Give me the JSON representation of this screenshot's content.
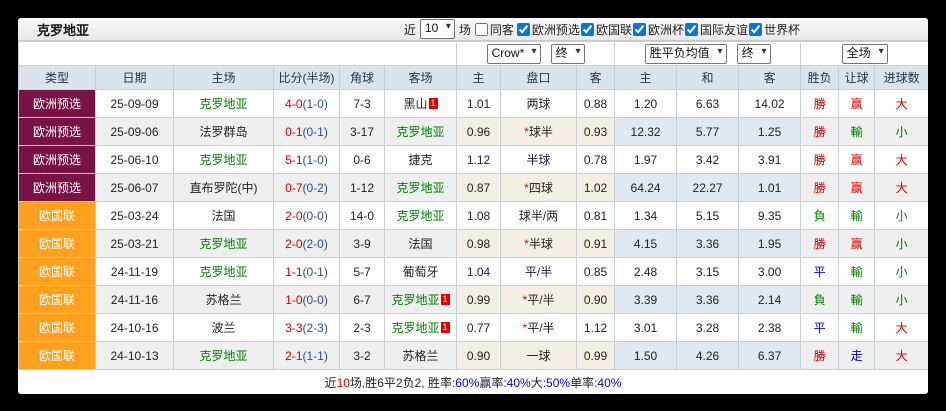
{
  "colors": {
    "comp_purple": "#7a1245",
    "comp_orange": "#ffa01e",
    "team_green": "#008000",
    "score_red": "#e10000",
    "half_score_navy": "#2f4e8e",
    "win_red": "#e10000",
    "loss_green": "#008000",
    "draw_blue": "#0000e6",
    "checkbox_accent": "#0b76d1",
    "header_bg": "#dbe4ed",
    "handicap_col_bg": "#fdf8f0",
    "avg_col_bg": "#e8f2f9"
  },
  "titlebar": {
    "title": "克罗地亚",
    "recent_label": "近",
    "recent_value": "10",
    "matches_label": "场",
    "same_away": {
      "label": "同客",
      "checked": false
    },
    "filters": [
      {
        "label": "欧洲预选",
        "checked": true
      },
      {
        "label": "欧国联",
        "checked": true
      },
      {
        "label": "欧洲杯",
        "checked": true
      },
      {
        "label": "国际友谊",
        "checked": true
      },
      {
        "label": "世界杯",
        "checked": true
      }
    ]
  },
  "controls": {
    "company": "Crow*",
    "final_a": "终",
    "avg": "胜平负均值",
    "final_b": "终",
    "scope": "全场"
  },
  "table": {
    "headers": [
      "类型",
      "日期",
      "主场",
      "比分(半场)",
      "角球",
      "客场",
      "主",
      "盘口",
      "客",
      "主",
      "和",
      "客",
      "胜负",
      "让球",
      "进球数"
    ],
    "rows": [
      {
        "type": "欧洲预选",
        "type_class": "comp-purple",
        "date": "25-09-09",
        "home": "克罗地亚",
        "home_green": true,
        "home_badge": "",
        "score": "4-0",
        "half": "(1-0)",
        "corners": "7-3",
        "away": "黑山",
        "away_green": false,
        "away_badge": "1",
        "let_home": "1.01",
        "handicap_star": "",
        "handicap": "两球",
        "let_away": "0.88",
        "avg_home": "1.20",
        "avg_draw": "6.63",
        "avg_away": "14.02",
        "result": {
          "t": "勝",
          "c": "red"
        },
        "let_result": {
          "t": "赢",
          "c": "red"
        },
        "goals": {
          "t": "大",
          "c": "red"
        }
      },
      {
        "type": "欧洲预选",
        "type_class": "comp-purple",
        "date": "25-09-06",
        "home": "法罗群岛",
        "home_green": false,
        "home_badge": "",
        "score": "0-1",
        "half": "(0-1)",
        "corners": "3-17",
        "away": "克罗地亚",
        "away_green": true,
        "away_badge": "",
        "let_home": "0.96",
        "handicap_star": "*",
        "handicap": "球半",
        "let_away": "0.93",
        "avg_home": "12.32",
        "avg_draw": "5.77",
        "avg_away": "1.25",
        "result": {
          "t": "勝",
          "c": "red"
        },
        "let_result": {
          "t": "輸",
          "c": "green"
        },
        "goals": {
          "t": "小",
          "c": "green"
        }
      },
      {
        "type": "欧洲预选",
        "type_class": "comp-purple",
        "date": "25-06-10",
        "home": "克罗地亚",
        "home_green": true,
        "home_badge": "",
        "score": "5-1",
        "half": "(1-0)",
        "corners": "0-6",
        "away": "捷克",
        "away_green": false,
        "away_badge": "",
        "let_home": "1.12",
        "handicap_star": "",
        "handicap": "半球",
        "let_away": "0.78",
        "avg_home": "1.97",
        "avg_draw": "3.42",
        "avg_away": "3.91",
        "result": {
          "t": "勝",
          "c": "red"
        },
        "let_result": {
          "t": "赢",
          "c": "red"
        },
        "goals": {
          "t": "大",
          "c": "red"
        }
      },
      {
        "type": "欧洲预选",
        "type_class": "comp-purple",
        "date": "25-06-07",
        "home": "直布罗陀(中)",
        "home_green": false,
        "home_badge": "",
        "score": "0-7",
        "half": "(0-2)",
        "corners": "1-12",
        "away": "克罗地亚",
        "away_green": true,
        "away_badge": "",
        "let_home": "0.87",
        "handicap_star": "*",
        "handicap": "四球",
        "let_away": "1.02",
        "avg_home": "64.24",
        "avg_draw": "22.27",
        "avg_away": "1.01",
        "result": {
          "t": "勝",
          "c": "red"
        },
        "let_result": {
          "t": "赢",
          "c": "red"
        },
        "goals": {
          "t": "大",
          "c": "red"
        }
      },
      {
        "type": "欧国联",
        "type_class": "comp-orange",
        "date": "25-03-24",
        "home": "法国",
        "home_green": false,
        "home_badge": "",
        "score": "2-0",
        "half": "(0-0)",
        "corners": "14-0",
        "away": "克罗地亚",
        "away_green": true,
        "away_badge": "",
        "let_home": "1.08",
        "handicap_star": "",
        "handicap": "球半/两",
        "let_away": "0.81",
        "avg_home": "1.34",
        "avg_draw": "5.15",
        "avg_away": "9.35",
        "result": {
          "t": "負",
          "c": "green"
        },
        "let_result": {
          "t": "輸",
          "c": "green"
        },
        "goals": {
          "t": "小",
          "c": "green"
        }
      },
      {
        "type": "欧国联",
        "type_class": "comp-orange",
        "date": "25-03-21",
        "home": "克罗地亚",
        "home_green": true,
        "home_badge": "",
        "score": "2-0",
        "half": "(2-0)",
        "corners": "3-9",
        "away": "法国",
        "away_green": false,
        "away_badge": "",
        "let_home": "0.98",
        "handicap_star": "*",
        "handicap": "半球",
        "let_away": "0.91",
        "avg_home": "4.15",
        "avg_draw": "3.36",
        "avg_away": "1.95",
        "result": {
          "t": "勝",
          "c": "red"
        },
        "let_result": {
          "t": "赢",
          "c": "red"
        },
        "goals": {
          "t": "小",
          "c": "green"
        }
      },
      {
        "type": "欧国联",
        "type_class": "comp-orange",
        "date": "24-11-19",
        "home": "克罗地亚",
        "home_green": true,
        "home_badge": "",
        "score": "1-1",
        "half": "(0-1)",
        "corners": "5-7",
        "away": "葡萄牙",
        "away_green": false,
        "away_badge": "",
        "let_home": "1.04",
        "handicap_star": "",
        "handicap": "平/半",
        "let_away": "0.85",
        "avg_home": "2.48",
        "avg_draw": "3.15",
        "avg_away": "3.00",
        "result": {
          "t": "平",
          "c": "blue"
        },
        "let_result": {
          "t": "輸",
          "c": "green"
        },
        "goals": {
          "t": "小",
          "c": "green"
        }
      },
      {
        "type": "欧国联",
        "type_class": "comp-orange",
        "date": "24-11-16",
        "home": "苏格兰",
        "home_green": false,
        "home_badge": "",
        "score": "1-0",
        "half": "(0-0)",
        "corners": "6-7",
        "away": "克罗地亚",
        "away_green": true,
        "away_badge": "1",
        "let_home": "0.99",
        "handicap_star": "*",
        "handicap": "平/半",
        "let_away": "0.90",
        "avg_home": "3.39",
        "avg_draw": "3.36",
        "avg_away": "2.14",
        "result": {
          "t": "負",
          "c": "green"
        },
        "let_result": {
          "t": "輸",
          "c": "green"
        },
        "goals": {
          "t": "小",
          "c": "green"
        }
      },
      {
        "type": "欧国联",
        "type_class": "comp-orange",
        "date": "24-10-16",
        "home": "波兰",
        "home_green": false,
        "home_badge": "",
        "score": "3-3",
        "half": "(2-3)",
        "corners": "2-3",
        "away": "克罗地亚",
        "away_green": true,
        "away_badge": "1",
        "let_home": "0.77",
        "handicap_star": "*",
        "handicap": "平/半",
        "let_away": "1.12",
        "avg_home": "3.01",
        "avg_draw": "3.28",
        "avg_away": "2.38",
        "result": {
          "t": "平",
          "c": "blue"
        },
        "let_result": {
          "t": "輸",
          "c": "green"
        },
        "goals": {
          "t": "大",
          "c": "red"
        }
      },
      {
        "type": "欧国联",
        "type_class": "comp-orange",
        "date": "24-10-13",
        "home": "克罗地亚",
        "home_green": true,
        "home_badge": "",
        "score": "2-1",
        "half": "(1-1)",
        "corners": "3-2",
        "away": "苏格兰",
        "away_green": false,
        "away_badge": "",
        "let_home": "0.90",
        "handicap_star": "",
        "handicap": "一球",
        "let_away": "0.99",
        "avg_home": "1.50",
        "avg_draw": "4.26",
        "avg_away": "6.37",
        "result": {
          "t": "勝",
          "c": "red"
        },
        "let_result": {
          "t": "走",
          "c": "blue"
        },
        "goals": {
          "t": "大",
          "c": "red"
        }
      }
    ]
  },
  "footer": {
    "segments": [
      {
        "t": "近",
        "c": "dark"
      },
      {
        "t": "10",
        "c": "red"
      },
      {
        "t": "场,胜6平2负2, 胜率",
        "c": "dark"
      },
      {
        "t": ":60%",
        "c": "blue"
      },
      {
        "t": " 赢率",
        "c": "dark"
      },
      {
        "t": ":40%",
        "c": "blue"
      },
      {
        "t": " 大",
        "c": "dark"
      },
      {
        "t": ":50%",
        "c": "blue"
      },
      {
        "t": " 单率",
        "c": "dark"
      },
      {
        "t": ":40%",
        "c": "blue"
      }
    ]
  }
}
